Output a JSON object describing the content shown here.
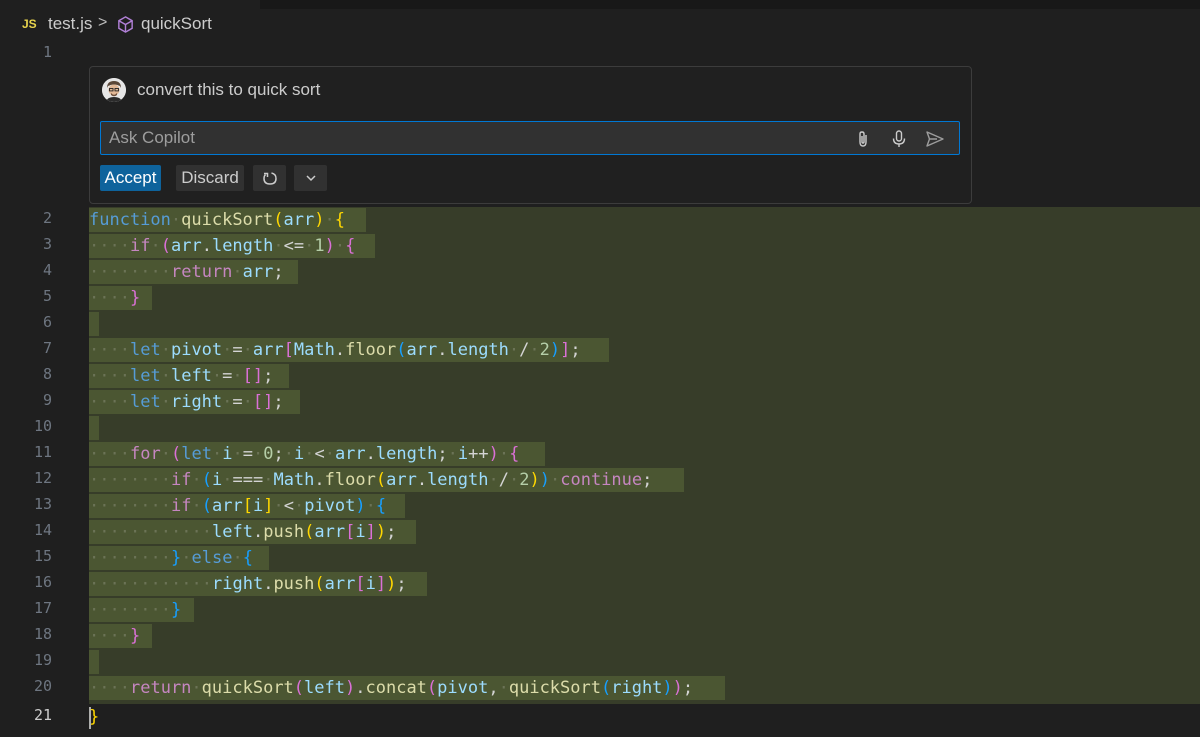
{
  "breadcrumb": {
    "file_badge": "JS",
    "file_name": "test.js",
    "separator": ">",
    "symbol_icon": "cube-symbol-icon",
    "symbol_name": "quickSort"
  },
  "inline_chat": {
    "user_message": "convert this to quick sort",
    "input_placeholder": "Ask Copilot",
    "input_value": "",
    "accept_label": "Accept",
    "discard_label": "Discard",
    "icons": [
      "avatar",
      "paperclip-icon",
      "microphone-icon",
      "send-icon",
      "refresh-icon",
      "chevron-down-icon"
    ]
  },
  "editor": {
    "accent_color": "#0078d4",
    "inserted_highlight_color": "#373d29",
    "active_line": 21,
    "line_numbers": [
      "1",
      "2",
      "3",
      "4",
      "5",
      "6",
      "7",
      "8",
      "9",
      "10",
      "11",
      "12",
      "13",
      "14",
      "15",
      "16",
      "17",
      "18",
      "19",
      "20",
      "21"
    ],
    "code_lines": [
      "",
      "function quickSort(arr) {",
      "    if (arr.length <= 1) {",
      "        return arr;",
      "    }",
      "",
      "    let pivot = arr[Math.floor(arr.length / 2)];",
      "    let left = [];",
      "    let right = [];",
      "",
      "    for (let i = 0; i < arr.length; i++) {",
      "        if (i === Math.floor(arr.length / 2)) continue;",
      "        if (arr[i] < pivot) {",
      "            left.push(arr[i]);",
      "        } else {",
      "            right.push(arr[i]);",
      "        }",
      "    }",
      "",
      "    return quickSort(left).concat(pivot, quickSort(right));",
      "}"
    ]
  }
}
